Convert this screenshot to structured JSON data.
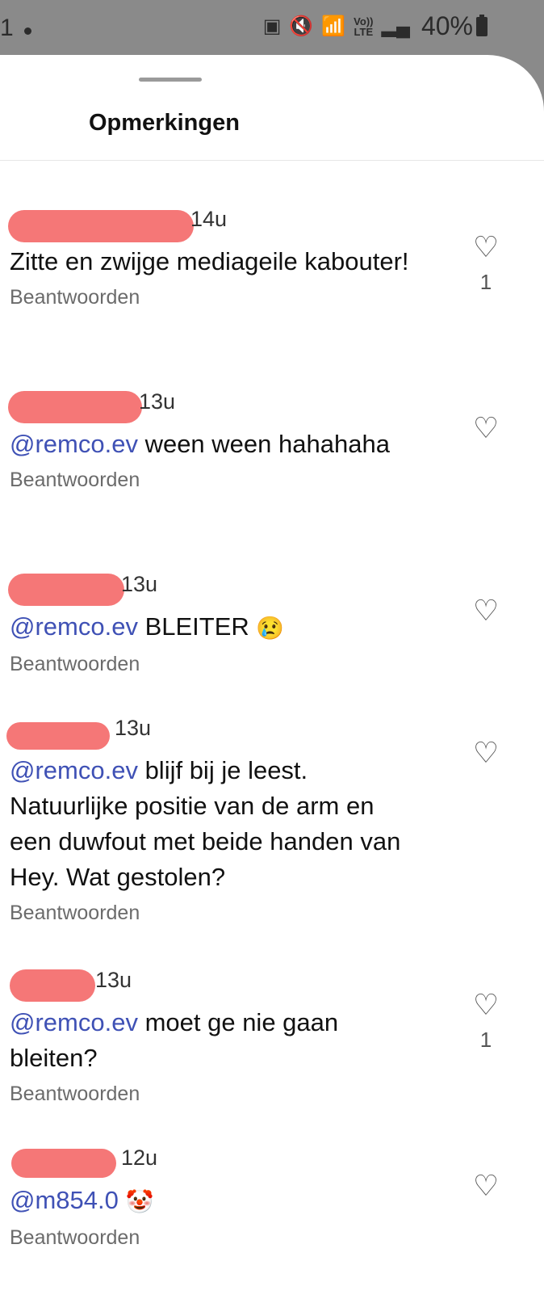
{
  "status_bar": {
    "left_glyph": "1",
    "battery_percent": "40%",
    "network": "LTE",
    "volte": "Vo))"
  },
  "sheet": {
    "title": "Opmerkingen"
  },
  "comments": [
    {
      "time": "14u",
      "mention": "",
      "text": "Zitte en zwijge mediageile kabouter!",
      "emoji": "",
      "reply": "Beantwoorden",
      "likes": "1"
    },
    {
      "time": "13u",
      "mention": "@remco.ev",
      "text": " ween ween hahahaha",
      "emoji": "",
      "reply": "Beantwoorden",
      "likes": ""
    },
    {
      "time": "13u",
      "mention": "@remco.ev",
      "text": " BLEITER ",
      "emoji": "😢",
      "reply": "Beantwoorden",
      "likes": ""
    },
    {
      "time": "13u",
      "mention": "@remco.ev",
      "text": " blijf bij je leest. Natuurlijke positie van de arm en een duwfout met beide handen van Hey. Wat gestolen?",
      "emoji": "",
      "reply": "Beantwoorden",
      "likes": ""
    },
    {
      "time": "13u",
      "mention": "@remco.ev",
      "text": " moet ge nie gaan bleiten?",
      "emoji": "",
      "reply": "Beantwoorden",
      "likes": "1"
    },
    {
      "time": "12u",
      "mention": "@m854.0",
      "text": " ",
      "emoji": "🤡",
      "reply": "Beantwoorden",
      "likes": ""
    }
  ],
  "colors": {
    "mention": "#3f51b5",
    "redaction": "#f57777",
    "status_bar_bg": "#8a8a8a"
  }
}
